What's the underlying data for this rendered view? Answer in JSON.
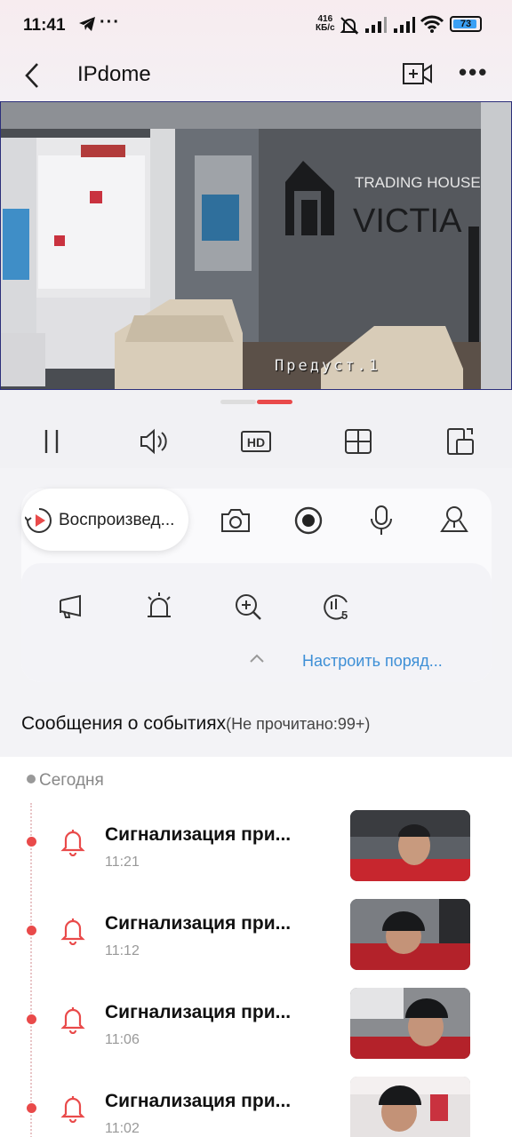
{
  "status_bar": {
    "time": "11:41",
    "dots": "···",
    "speed_value": "416",
    "speed_unit": "КБ/с",
    "battery": "73"
  },
  "header": {
    "title": "IPdome"
  },
  "video": {
    "osd_label": "Предуст.1"
  },
  "panel": {
    "playback_label": "Воспроизвед...",
    "customize_order": "Настроить поряд..."
  },
  "events": {
    "heading": "Сообщения о событиях",
    "unread": "(Не прочитано:99+)",
    "group": "Сегодня",
    "items": [
      {
        "title": "Сигнализация при...",
        "time": "11:21"
      },
      {
        "title": "Сигнализация при...",
        "time": "11:12"
      },
      {
        "title": "Сигнализация при...",
        "time": "11:06"
      },
      {
        "title": "Сигнализация при...",
        "time": "11:02"
      }
    ]
  },
  "colors": {
    "accent": "#e94a4a",
    "link": "#3d8fd6"
  }
}
